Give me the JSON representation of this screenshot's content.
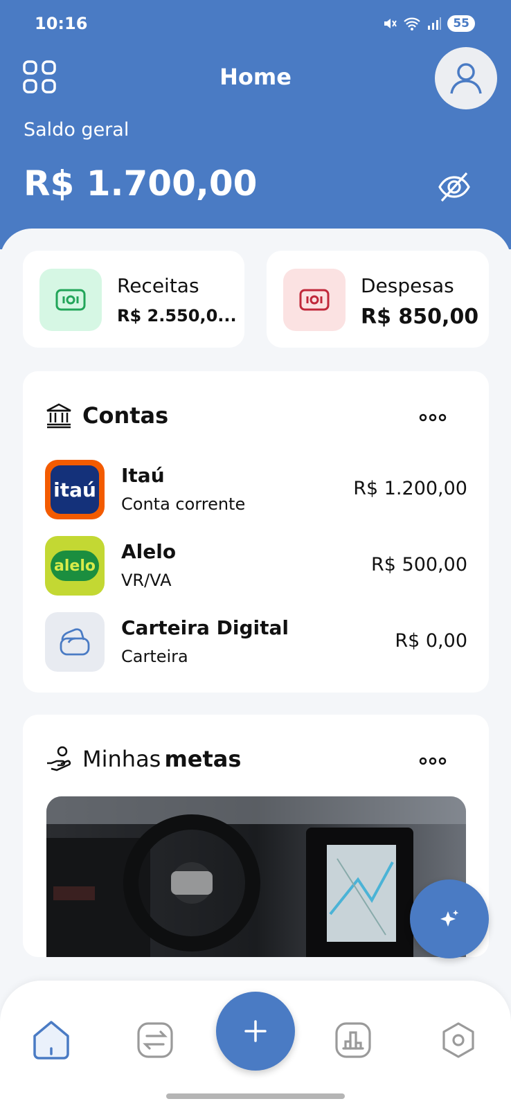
{
  "status": {
    "time": "10:16",
    "battery": "55"
  },
  "header": {
    "title": "Home",
    "balance_label": "Saldo geral",
    "balance_value": "R$ 1.700,00"
  },
  "summary": {
    "income": {
      "label": "Receitas",
      "value": "R$ 2.550,0..."
    },
    "expense": {
      "label": "Despesas",
      "value": "R$ 850,00"
    }
  },
  "accounts": {
    "title": "Contas",
    "items": [
      {
        "name": "Itaú",
        "type": "Conta corrente",
        "amount": "R$ 1.200,00",
        "logo_text": "itaú"
      },
      {
        "name": "Alelo",
        "type": "VR/VA",
        "amount": "R$ 500,00",
        "logo_text": "alelo"
      },
      {
        "name": "Carteira Digital",
        "type": "Carteira",
        "amount": "R$ 0,00"
      }
    ]
  },
  "goals": {
    "title_prefix": "Minhas",
    "title_bold": "metas"
  },
  "colors": {
    "primary": "#4a7bc4",
    "income_bg": "#d6f7e4",
    "income_fg": "#22a559",
    "expense_bg": "#fbe2e2",
    "expense_fg": "#c0283a"
  },
  "icons": {
    "header_left": "grid-icon",
    "profile": "user-icon",
    "visibility": "eye-off-icon",
    "nav": [
      "home-icon",
      "transfer-icon",
      "add-icon",
      "chart-icon",
      "settings-icon"
    ]
  }
}
